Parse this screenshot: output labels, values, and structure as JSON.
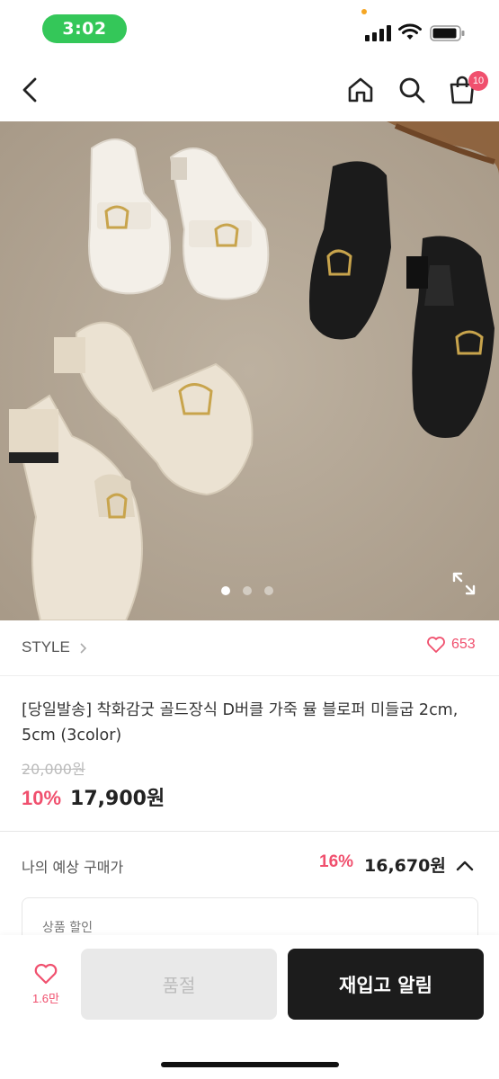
{
  "status_bar": {
    "time": "3:02"
  },
  "nav": {
    "cart_count": "10"
  },
  "product_image": {
    "description_icons": [
      "shoe-photo"
    ],
    "slide_count": 3,
    "active_slide": 1
  },
  "brand": {
    "name": "STYLE",
    "like_count": "653"
  },
  "product": {
    "title": "[당일발송] 착화감굿 골드장식 D버클 가죽 뮬 블로퍼 미들굽 2cm, 5cm (3color)",
    "original_price": "20,000원",
    "discount_rate": "10%",
    "sale_price": "17,900원"
  },
  "expected": {
    "label": "나의 예상 구매가",
    "rate": "16%",
    "price": "16,670원"
  },
  "discount_box": {
    "label": "상품 할인"
  },
  "bottom_bar": {
    "wish_count": "1.6만",
    "soldout_label": "품절",
    "restock_label": "재입고 알림"
  },
  "colors": {
    "accent": "#f0506e",
    "status_green": "#34c759",
    "dark_button": "#1c1c1c"
  }
}
